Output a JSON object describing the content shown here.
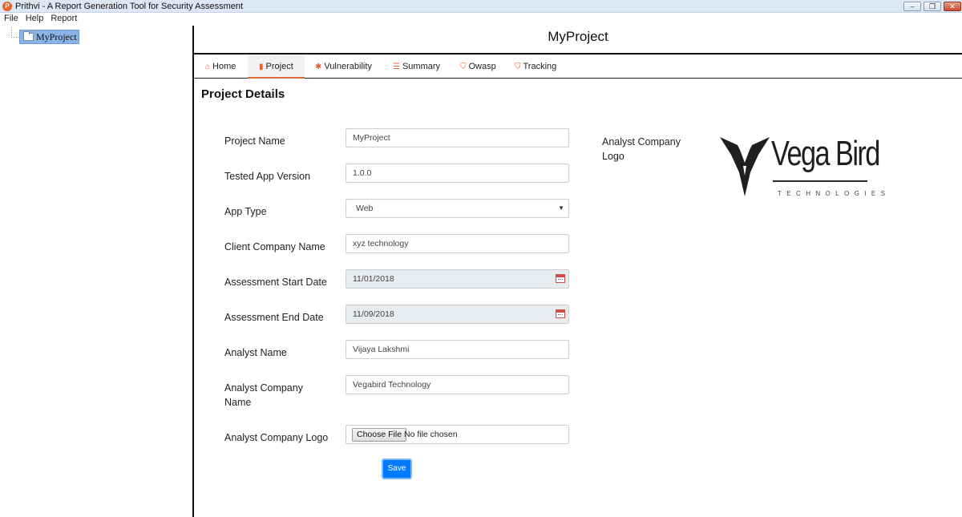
{
  "window": {
    "title": "Prithvi - A Report Generation Tool for Security Assessment",
    "minimize": "–",
    "maximize": "❐",
    "close": "✕"
  },
  "menu": [
    "File",
    "Help",
    "Report"
  ],
  "tree": {
    "root_label": "MyProject"
  },
  "header": {
    "title": "MyProject"
  },
  "tabs": [
    {
      "label": "Home",
      "icon": "home-icon",
      "glyph": "⌂"
    },
    {
      "label": "Project",
      "icon": "file-icon",
      "glyph": "▮"
    },
    {
      "label": "Vulnerability",
      "icon": "bug-icon",
      "glyph": "✱"
    },
    {
      "label": "Summary",
      "icon": "list-icon",
      "glyph": "☰"
    },
    {
      "label": "Owasp",
      "icon": "shield-icon",
      "glyph": "⛉"
    },
    {
      "label": "Tracking",
      "icon": "shield-icon",
      "glyph": "⛉"
    }
  ],
  "active_tab": "Project",
  "section_title": "Project Details",
  "form": {
    "project_name": {
      "label": "Project Name",
      "value": "MyProject"
    },
    "app_version": {
      "label": "Tested App Version",
      "value": "1.0.0"
    },
    "app_type": {
      "label": "App Type",
      "value": "Web"
    },
    "client_company": {
      "label": "Client Company Name",
      "value": "xyz technology"
    },
    "start_date": {
      "label": "Assessment Start Date",
      "value": "11/01/2018"
    },
    "end_date": {
      "label": "Assessment End Date",
      "value": "11/09/2018"
    },
    "analyst_name": {
      "label": "Analyst Name",
      "value": "Vijaya Lakshmi"
    },
    "analyst_company": {
      "label_line1": "Analyst Company",
      "label_line2": "Name",
      "value": "Vegabird Technology"
    },
    "analyst_logo": {
      "label": "Analyst Company Logo",
      "button": "Choose File",
      "status": "No file chosen"
    }
  },
  "save_label": "Save",
  "logo_panel": {
    "label_line1": "Analyst Company",
    "label_line2": "Logo",
    "logo_name": "Vega Bird",
    "logo_sub": "TECHNOLOGIES"
  },
  "colors": {
    "accent": "#e8632b",
    "primary_button": "#007bff",
    "tree_selection": "#8bb4e6"
  }
}
